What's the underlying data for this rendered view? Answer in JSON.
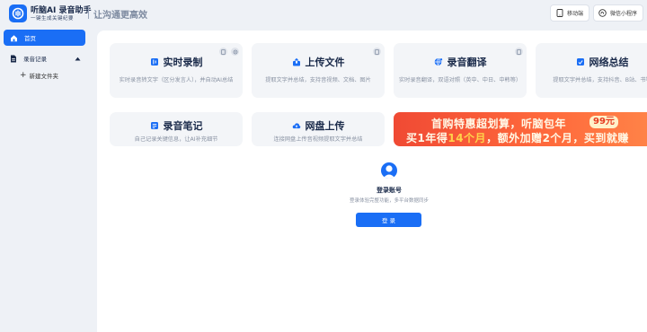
{
  "header": {
    "brand_title": "听脑AI 录音助手",
    "brand_subtitle": "一键生成关键纪要",
    "slogan": "让沟通更高效",
    "mobile_label": "移动端",
    "miniprogram_label": "微信小程序"
  },
  "sidebar": {
    "home_label": "首页",
    "records_label": "录音记录",
    "new_folder_label": "新建文件夹"
  },
  "cards": [
    {
      "title": "实时录制",
      "desc": "实时录音转文字（区分发言人），并自动AI总结"
    },
    {
      "title": "上传文件",
      "desc": "提取文字并总结，支持音视频、文档、图片"
    },
    {
      "title": "录音翻译",
      "desc": "实时录音翻译，双语对照（英中、中日、中韩等）"
    },
    {
      "title": "网络总结",
      "desc": "提取文字并总结，支持抖音、B站、书等"
    },
    {
      "title": "录音笔记",
      "desc": "自己记录关键信息，让AI补充细节"
    },
    {
      "title": "网盘上传",
      "desc": "连接网盘上传音视频提取文字并总结"
    }
  ],
  "promo": {
    "line1": "首购特惠超划算，听脑包年",
    "price": "99元",
    "line2_a": "买1年得",
    "line2_b": "14个月",
    "line2_c": "，额外加赠2个月，买到就赚"
  },
  "login": {
    "title": "登录账号",
    "subtitle": "登录体验完整功能，多平台数据同步",
    "button": "登 录"
  },
  "colors": {
    "accent": "#1a6ef5",
    "promo": "#f04a34"
  }
}
